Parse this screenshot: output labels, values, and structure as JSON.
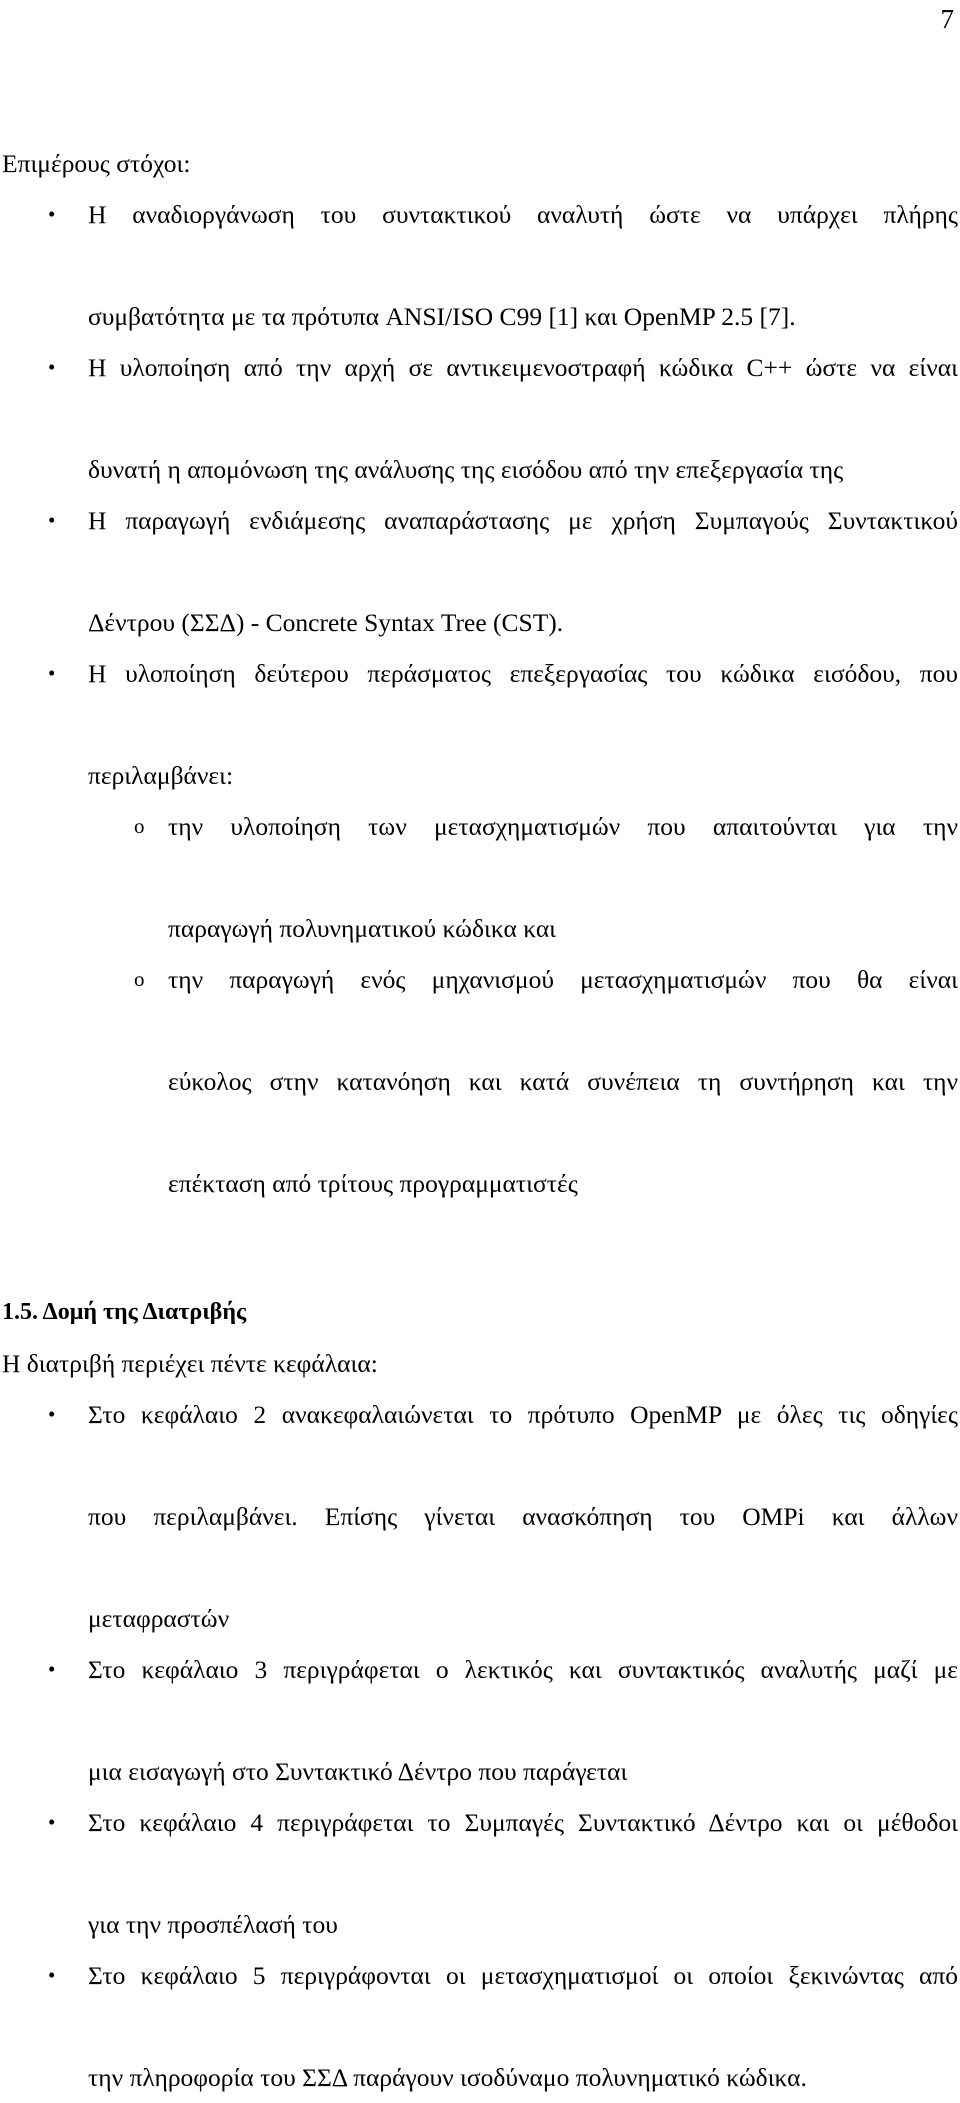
{
  "page": {
    "number": "7"
  },
  "intro": {
    "text": "Επιμέρους στόχοι:"
  },
  "objectives": {
    "marker": "•",
    "items": [
      {
        "lines": [
          "Η αναδιοργάνωση του συντακτικού αναλυτή ώστε να υπάρχει πλήρης",
          "συμβατότητα με τα πρότυπα ANSI/ISO C99 [1] και OpenMP 2.5 [7]."
        ]
      },
      {
        "lines": [
          "Η υλοποίηση από την αρχή σε αντικειμενοστραφή κώδικα C++ ώστε να είναι",
          "δυνατή η απομόνωση της ανάλυσης της εισόδου από την επεξεργασία της"
        ]
      },
      {
        "lines": [
          "Η παραγωγή ενδιάμεσης αναπαράστασης με χρήση Συμπαγούς Συντακτικού",
          "Δέντρου (ΣΣΔ) - Concrete Syntax Tree (CST)."
        ]
      },
      {
        "lines": [
          "Η υλοποίηση δεύτερου περάσματος επεξεργασίας του κώδικα εισόδου, που",
          "περιλαμβάνει:"
        ]
      }
    ]
  },
  "sub_objectives": {
    "marker": "o",
    "items": [
      {
        "lines": [
          "την υλοποίηση των μετασχηματισμών που απαιτούνται για την",
          "παραγωγή πολυνηματικού κώδικα και"
        ]
      },
      {
        "lines": [
          "την παραγωγή ενός μηχανισμού μετασχηματισμών που θα είναι",
          "εύκολος στην κατανόηση και κατά συνέπεια τη συντήρηση και την",
          "επέκταση από τρίτους προγραμματιστές"
        ]
      }
    ]
  },
  "section": {
    "heading": "1.5. Δομή της Διατριβής",
    "lead": "Η διατριβή περιέχει πέντε κεφάλαια:",
    "marker": "•",
    "items": [
      {
        "lines": [
          "Στο κεφάλαιο 2 ανακεφαλαιώνεται το πρότυπο OpenMP με όλες τις οδηγίες",
          "που περιλαμβάνει. Επίσης γίνεται  ανασκόπηση του OMPi και άλλων",
          "μεταφραστών"
        ]
      },
      {
        "lines": [
          "Στο κεφάλαιο 3 περιγράφεται ο λεκτικός και συντακτικός αναλυτής μαζί με",
          "μια εισαγωγή στο Συντακτικό Δέντρο που παράγεται"
        ]
      },
      {
        "lines": [
          "Στο κεφάλαιο 4 περιγράφεται το Συμπαγές Συντακτικό Δέντρο και οι μέθοδοι",
          "για την προσπέλασή του"
        ]
      },
      {
        "lines": [
          "Στο κεφάλαιο 5 περιγράφονται οι μετασχηματισμοί οι οποίοι ξεκινώντας από",
          "την πληροφορία του ΣΣΔ παράγουν ισοδύναμο πολυνηματικό κώδικα."
        ]
      }
    ]
  }
}
